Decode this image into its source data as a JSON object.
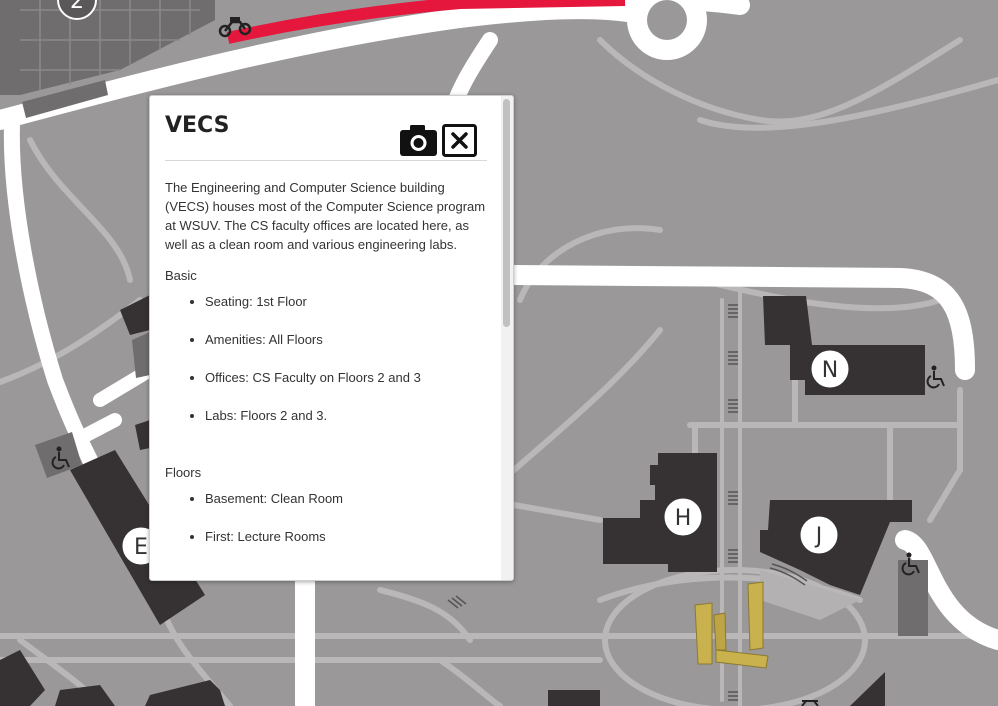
{
  "map": {
    "building_labels": [
      "2",
      "N",
      "H",
      "J",
      "E"
    ],
    "colors": {
      "ground": "#9a9899",
      "path": "#b9b7b8",
      "road": "#ffffff",
      "building": "#363234",
      "parking": "#6f6d6e",
      "highlight_route": "#e5173d",
      "sculpture": "#c9b14d"
    },
    "icons": [
      "motorcycle-icon",
      "accessible-icon",
      "accessible-icon",
      "accessible-icon"
    ]
  },
  "popup": {
    "title": "VECS",
    "camera_icon": "camera-icon",
    "close_icon": "close-icon",
    "description": "The Engineering and Computer Science building (VECS) houses most of the Computer Science program at WSUV. The CS faculty offices are located here, as well as a clean room and various engineering labs.",
    "sections": [
      {
        "label": "Basic",
        "items": [
          "Seating: 1st Floor",
          "Amenities: All Floors",
          "Offices: CS Faculty on Floors 2 and 3",
          "Labs: Floors 2 and 3."
        ]
      },
      {
        "label": "Floors",
        "items": [
          "Basement: Clean Room",
          "First: Lecture Rooms"
        ]
      }
    ]
  }
}
